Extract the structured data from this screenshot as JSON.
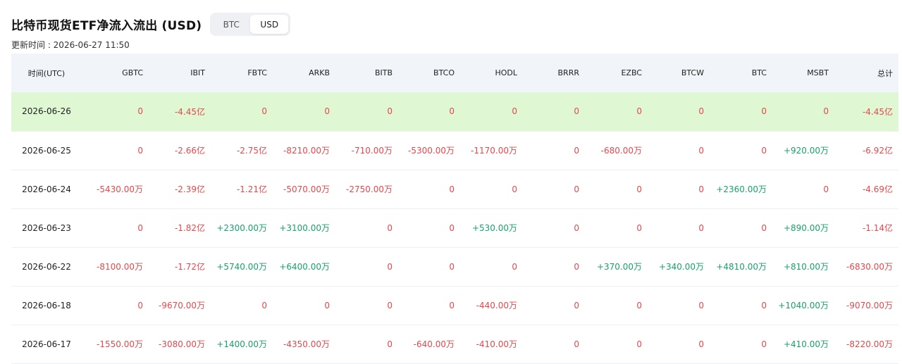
{
  "title": "比特币现货ETF净流入流出 (USD)",
  "toggle": {
    "options": [
      "BTC",
      "USD"
    ],
    "selected": "USD"
  },
  "updated": "更新时间 : 2026-06-27 11:50",
  "colors": {
    "negative": "#e5484d",
    "positive": "#17a36b",
    "highlight": "#dff7d3",
    "header_bg": "#f1f4f8"
  },
  "table": {
    "columns": [
      "时间(UTC)",
      "GBTC",
      "IBIT",
      "FBTC",
      "ARKB",
      "BITB",
      "BTCO",
      "HODL",
      "BRRR",
      "EZBC",
      "BTCW",
      "BTC",
      "MSBT",
      "总计"
    ],
    "rows": [
      [
        "2026-06-26",
        "0",
        "-4.45亿",
        "0",
        "0",
        "0",
        "0",
        "0",
        "0",
        "0",
        "0",
        "0",
        "0",
        "-4.45亿"
      ],
      [
        "2026-06-25",
        "0",
        "-2.66亿",
        "-2.75亿",
        "-8210.00万",
        "-710.00万",
        "-5300.00万",
        "-1170.00万",
        "0",
        "-680.00万",
        "0",
        "0",
        "+920.00万",
        "-6.92亿"
      ],
      [
        "2026-06-24",
        "-5430.00万",
        "-2.39亿",
        "-1.21亿",
        "-5070.00万",
        "-2750.00万",
        "0",
        "0",
        "0",
        "0",
        "0",
        "+2360.00万",
        "0",
        "-4.69亿"
      ],
      [
        "2026-06-23",
        "0",
        "-1.82亿",
        "+2300.00万",
        "+3100.00万",
        "0",
        "0",
        "+530.00万",
        "0",
        "0",
        "0",
        "0",
        "+890.00万",
        "-1.14亿"
      ],
      [
        "2026-06-22",
        "-8100.00万",
        "-1.72亿",
        "+5740.00万",
        "+6400.00万",
        "0",
        "0",
        "0",
        "0",
        "+370.00万",
        "+340.00万",
        "+4810.00万",
        "+810.00万",
        "-6830.00万"
      ],
      [
        "2026-06-18",
        "0",
        "-9670.00万",
        "0",
        "0",
        "0",
        "0",
        "-440.00万",
        "0",
        "0",
        "0",
        "0",
        "+1040.00万",
        "-9070.00万"
      ],
      [
        "2026-06-17",
        "-1550.00万",
        "-3080.00万",
        "+1400.00万",
        "-4350.00万",
        "0",
        "-640.00万",
        "-410.00万",
        "0",
        "0",
        "0",
        "0",
        "+410.00万",
        "-8220.00万"
      ]
    ],
    "highlighted_row": 0
  }
}
